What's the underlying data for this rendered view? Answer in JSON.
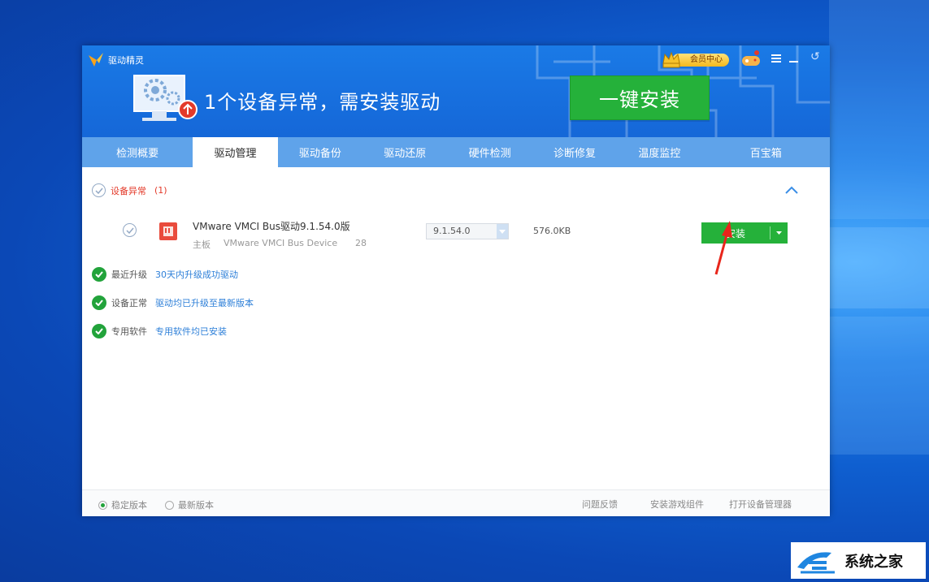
{
  "app": {
    "title": "驱动精灵"
  },
  "header": {
    "vip_label": "会员中心",
    "headline": "1个设备异常，需安装驱动",
    "one_key_install": "一键安装"
  },
  "tabs": [
    {
      "label": "检测概要"
    },
    {
      "label": "驱动管理"
    },
    {
      "label": "驱动备份"
    },
    {
      "label": "驱动还原"
    },
    {
      "label": "硬件检测"
    },
    {
      "label": "诊断修复"
    },
    {
      "label": "温度监控"
    },
    {
      "label": "百宝箱"
    }
  ],
  "active_tab": "驱动管理",
  "section": {
    "title": "设备异常",
    "count": "(1)"
  },
  "driver": {
    "name": "VMware VMCI Bus驱动9.1.54.0版",
    "category": "主板",
    "device": "VMware VMCI Bus Device",
    "date": "28",
    "version": "9.1.54.0",
    "size": "576.0KB",
    "install_label": "安装"
  },
  "statuses": [
    {
      "title": "最近升级",
      "desc": "30天内升级成功驱动"
    },
    {
      "title": "设备正常",
      "desc": "驱动均已升级至最新版本"
    },
    {
      "title": "专用软件",
      "desc": "专用软件均已安装"
    }
  ],
  "footer": {
    "stable": "稳定版本",
    "latest": "最新版本",
    "feedback": "问题反馈",
    "game_components": "安装游戏组件",
    "device_manager": "打开设备管理器"
  },
  "watermark": {
    "text": "系统之家"
  },
  "colors": {
    "accent": "#1a7ae6",
    "green": "#25b13a",
    "alert": "#e33a2a",
    "link": "#2d7fd8"
  }
}
